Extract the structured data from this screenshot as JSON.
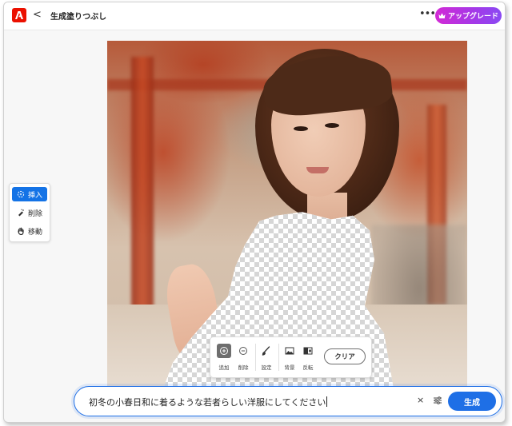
{
  "header": {
    "logo_icon": "adobe-logo-icon",
    "back_icon": "chevron-left-icon",
    "back_symbol": "<",
    "title": "生成塗りつぶし",
    "more_symbol": "•••",
    "upgrade_label": "アップグレード",
    "upgrade_icon": "crown-icon",
    "accent": "#eb1000"
  },
  "tools": {
    "items": [
      {
        "label": "挿入",
        "icon": "insert-sparkle-icon",
        "active": true
      },
      {
        "label": "削除",
        "icon": "remove-brush-icon",
        "active": false
      },
      {
        "label": "移動",
        "icon": "hand-pan-icon",
        "active": false
      }
    ],
    "active_color": "#1473e6"
  },
  "palette": {
    "add_label": "追加",
    "subtract_label": "削除",
    "settings_label": "設定",
    "background_label": "背景",
    "invert_label": "反転",
    "clear_label": "クリア"
  },
  "prompt": {
    "value": "初冬の小春日和に着るような若者らしい洋服にしてください",
    "clear_symbol": "×",
    "generate_label": "生成",
    "generate_color": "#1e6fe6"
  }
}
